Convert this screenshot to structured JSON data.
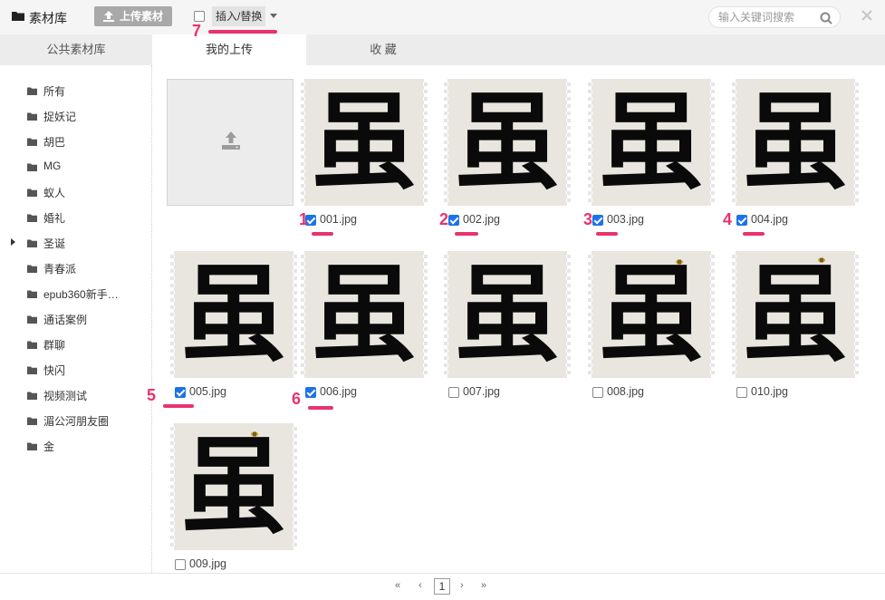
{
  "header": {
    "title": "素材库",
    "upload_label": "上传素材",
    "mode_label": "插入/替换",
    "search_placeholder": "输入关键词搜索"
  },
  "tabs": [
    {
      "label": "公共素材库",
      "active": false
    },
    {
      "label": "我的上传",
      "active": true
    },
    {
      "label": "收 藏",
      "active": false
    }
  ],
  "sidebar": {
    "items": [
      {
        "label": "所有"
      },
      {
        "label": "捉妖记"
      },
      {
        "label": "胡巴"
      },
      {
        "label": "MG"
      },
      {
        "label": "蚁人"
      },
      {
        "label": "婚礼"
      },
      {
        "label": "圣诞",
        "expandable": true
      },
      {
        "label": "青春派"
      },
      {
        "label": "epub360新手…"
      },
      {
        "label": "通话案例"
      },
      {
        "label": "群聊"
      },
      {
        "label": "快闪"
      },
      {
        "label": "视频测试"
      },
      {
        "label": "湄公河朋友圈"
      },
      {
        "label": "金"
      }
    ]
  },
  "thumbnail_glyph": "虽",
  "files": [
    {
      "name": "001.jpg",
      "checked": true,
      "annotation": "1"
    },
    {
      "name": "002.jpg",
      "checked": true,
      "annotation": "2"
    },
    {
      "name": "003.jpg",
      "checked": true,
      "annotation": "3"
    },
    {
      "name": "004.jpg",
      "checked": true,
      "annotation": "4"
    },
    {
      "name": "005.jpg",
      "checked": true,
      "annotation": "5"
    },
    {
      "name": "006.jpg",
      "checked": true,
      "annotation": "6"
    },
    {
      "name": "007.jpg",
      "checked": false
    },
    {
      "name": "008.jpg",
      "checked": false
    },
    {
      "name": "010.jpg",
      "checked": false
    },
    {
      "name": "009.jpg",
      "checked": false
    }
  ],
  "mode_annotation": "7",
  "pagination": {
    "first": "«",
    "prev": "‹",
    "current": "1",
    "next": "›",
    "last": "»"
  },
  "colors": {
    "annotation": "#e8336d",
    "checkbox_checked": "#1a73e8",
    "upload_button": "#a9a9a9"
  }
}
